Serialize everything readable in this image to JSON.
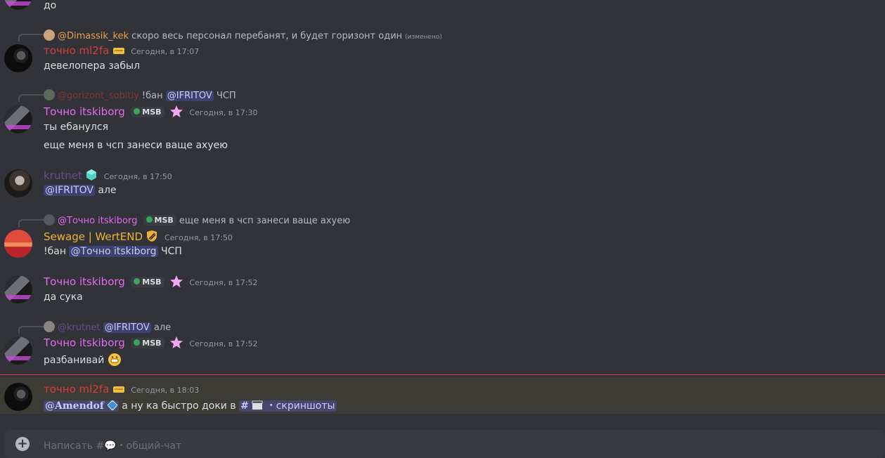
{
  "colors": {
    "background": "#313338",
    "mention_bg": "#454a7a",
    "highlight_bg": "#3d3b35",
    "new_divider": "#d83c3e",
    "ml2fa_name": "#d83c3e",
    "itskiborg_name": "#e36bf0",
    "krutnet_name": "#6b4c8c",
    "sewage_name": "#f0b132",
    "dimassik_name": "#e8a04a",
    "gorizont_name": "#7a3a3a"
  },
  "top_partial": {
    "text": "до"
  },
  "messages": [
    {
      "reply_author": "@Dimassik_kek",
      "reply_text": "скоро весь персонал перебанят, и будет горизонт один",
      "reply_edited": "(изменено)",
      "author": "точно ml2fa",
      "time": "Сегодня, в 17:07",
      "text": "девелопера забыл"
    },
    {
      "reply_author": "@gorizont_sobitiy",
      "reply_prefix": "!бан",
      "reply_mention": "@IFRITOV",
      "reply_suffix": "ЧСП",
      "author": "Точно itskiborg",
      "tag": "MSB",
      "time": "Сегодня, в 17:30",
      "text": "ты ебанулся",
      "text2": "еще меня в чсп занеси ваще ахуею"
    },
    {
      "author": "krutnet",
      "time": "Сегодня, в 17:50",
      "mention": "@IFRITOV",
      "text": "але"
    },
    {
      "reply_author": "@Точно itskiborg",
      "reply_tag": "MSB",
      "reply_text": "еще меня в чсп занеси ваще ахуею",
      "author": "Sewage | WertEND",
      "time": "Сегодня, в 17:50",
      "prefix": "!бан",
      "mention": "@Точно itskiborg",
      "suffix": "ЧСП"
    },
    {
      "author": "Точно itskiborg",
      "tag": "MSB",
      "time": "Сегодня, в 17:52",
      "text": "да сука"
    },
    {
      "reply_author": "@krutnet",
      "reply_mention": "@IFRITOV",
      "reply_text": "але",
      "author": "Точно itskiborg",
      "tag": "MSB",
      "time": "Сегодня, в 17:52",
      "text": "разбанивай"
    },
    {
      "author": "точно ml2fa",
      "time": "Сегодня, в 18:03",
      "mention": "@Amendof",
      "text": "а ну ка быстро доки в",
      "channel": "скриншоты"
    }
  ],
  "composer": {
    "placeholder": "Написать #💬・общий-чат"
  },
  "icons": [
    "plus-icon",
    "hash-icon",
    "clapper-icon",
    "crown-icon",
    "sparkle-icon",
    "cube-icon",
    "shield-badge-icon",
    "grin-emoji-icon",
    "diamond-icon",
    "leaf-icon"
  ]
}
